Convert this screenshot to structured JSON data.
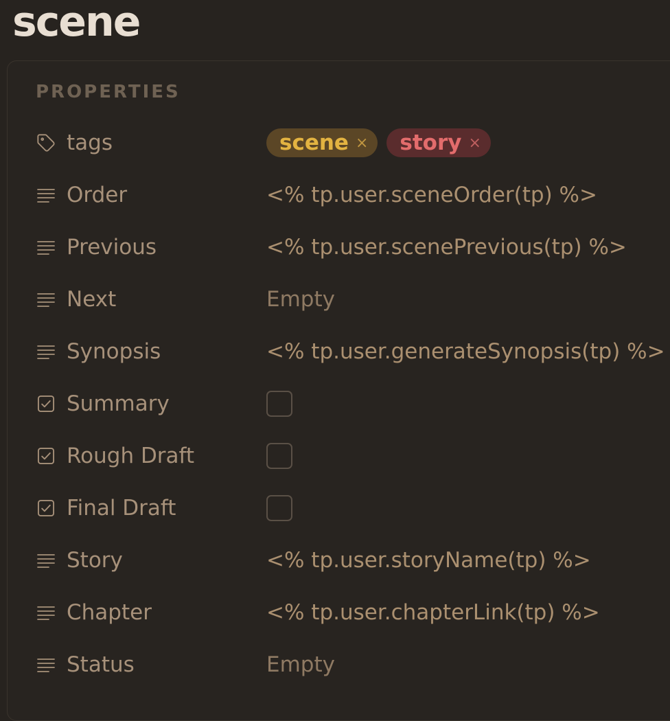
{
  "note": {
    "title": "scene"
  },
  "properties": {
    "heading": "PROPERTIES",
    "rows": [
      {
        "key": "tags",
        "icon": "tag-icon",
        "type": "tags",
        "tags": [
          {
            "label": "scene",
            "remove": "×",
            "color": "#e3b341"
          },
          {
            "label": "story",
            "remove": "×",
            "color": "#e36c6c"
          }
        ]
      },
      {
        "key": "Order",
        "icon": "text-lines-icon",
        "type": "text",
        "value": "<% tp.user.sceneOrder(tp) %>"
      },
      {
        "key": "Previous",
        "icon": "text-lines-icon",
        "type": "text",
        "value": "<% tp.user.scenePrevious(tp) %>"
      },
      {
        "key": "Next",
        "icon": "text-lines-icon",
        "type": "empty",
        "value": "Empty"
      },
      {
        "key": "Synopsis",
        "icon": "text-lines-icon",
        "type": "text",
        "value": "<% tp.user.generateSynopsis(tp) %>"
      },
      {
        "key": "Summary",
        "icon": "checkbox-icon",
        "type": "checkbox",
        "checked": false
      },
      {
        "key": "Rough Draft",
        "icon": "checkbox-icon",
        "type": "checkbox",
        "checked": false
      },
      {
        "key": "Final Draft",
        "icon": "checkbox-icon",
        "type": "checkbox",
        "checked": false
      },
      {
        "key": "Story",
        "icon": "text-lines-icon",
        "type": "text",
        "value": "<% tp.user.storyName(tp) %>"
      },
      {
        "key": "Chapter",
        "icon": "text-lines-icon",
        "type": "text",
        "value": "<% tp.user.chapterLink(tp) %>"
      },
      {
        "key": "Status",
        "icon": "text-lines-icon",
        "type": "empty",
        "value": "Empty"
      }
    ]
  },
  "colors": {
    "background": "#27231f",
    "label": "#a7917a",
    "value": "#ab9070",
    "tag_scene_bg": "#5b4626",
    "tag_story_bg": "#5a2c2d"
  }
}
